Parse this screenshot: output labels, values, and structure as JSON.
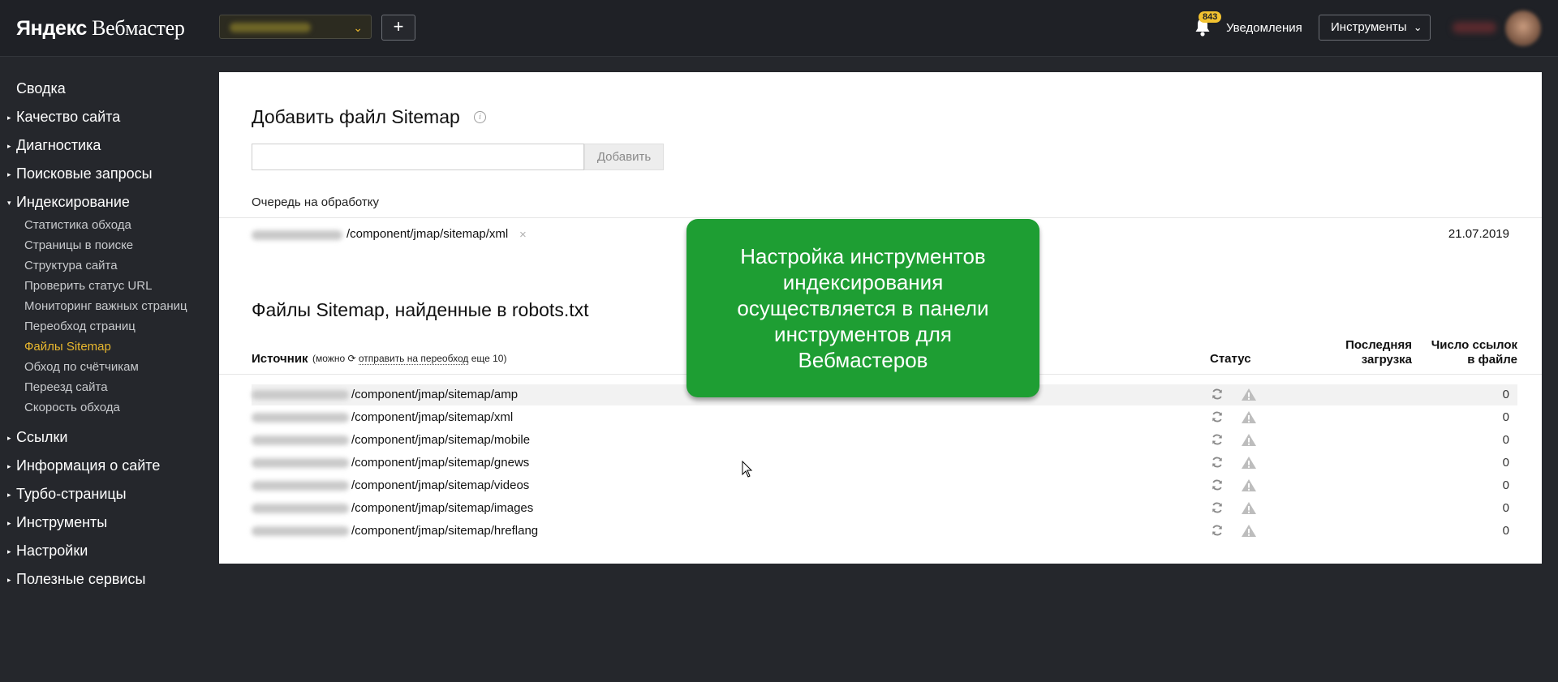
{
  "header": {
    "logo_brand": "Яндекс",
    "logo_product": "Вебмастер",
    "add_button": "+",
    "notifications_count": "843",
    "notifications_label": "Уведомления",
    "tools_label": "Инструменты",
    "tools_chevron": "⌄",
    "site_chevron": "⌄"
  },
  "sidebar": {
    "top_items": [
      {
        "label": "Сводка",
        "arrow": ""
      },
      {
        "label": "Качество сайта",
        "arrow": "▸"
      },
      {
        "label": "Диагностика",
        "arrow": "▸"
      },
      {
        "label": "Поисковые запросы",
        "arrow": "▸"
      },
      {
        "label": "Индексирование",
        "arrow": "▾"
      },
      {
        "label": "Ссылки",
        "arrow": "▸"
      },
      {
        "label": "Информация о сайте",
        "arrow": "▸"
      },
      {
        "label": "Турбо-страницы",
        "arrow": "▸"
      },
      {
        "label": "Инструменты",
        "arrow": "▸"
      },
      {
        "label": "Настройки",
        "arrow": "▸"
      },
      {
        "label": "Полезные сервисы",
        "arrow": "▸"
      }
    ],
    "indexing_items": [
      {
        "label": "Статистика обхода"
      },
      {
        "label": "Страницы в поиске"
      },
      {
        "label": "Структура сайта"
      },
      {
        "label": "Проверить статус URL"
      },
      {
        "label": "Мониторинг важных страниц"
      },
      {
        "label": "Переобход страниц"
      },
      {
        "label": "Файлы Sitemap"
      },
      {
        "label": "Обход по счётчикам"
      },
      {
        "label": "Переезд сайта"
      },
      {
        "label": "Скорость обхода"
      }
    ],
    "active_item": "Файлы Sitemap"
  },
  "add_sitemap": {
    "title": "Добавить файл Sitemap",
    "info_icon": "i",
    "input_value": "",
    "button_label": "Добавить"
  },
  "queue": {
    "title": "Очередь на обработку",
    "items": [
      {
        "url": "/component/jmap/sitemap/xml",
        "remove": "×",
        "date": "21.07.2019"
      }
    ]
  },
  "robots": {
    "title": "Файлы Sitemap, найденные в robots.txt",
    "col_source": "Источник",
    "note_prefix": "(можно ",
    "note_icon": "⟳",
    "note_link": "отправить на переобход",
    "note_suffix": " еще 10)",
    "col_status": "Статус",
    "col_last_line1": "Последняя",
    "col_last_line2": "загрузка",
    "col_count_line1": "Число ссылок",
    "col_count_line2": "в файле",
    "rows": [
      {
        "url": "/component/jmap/sitemap/amp",
        "count": "0"
      },
      {
        "url": "/component/jmap/sitemap/xml",
        "count": "0"
      },
      {
        "url": "/component/jmap/sitemap/mobile",
        "count": "0"
      },
      {
        "url": "/component/jmap/sitemap/gnews",
        "count": "0"
      },
      {
        "url": "/component/jmap/sitemap/videos",
        "count": "0"
      },
      {
        "url": "/component/jmap/sitemap/images",
        "count": "0"
      },
      {
        "url": "/component/jmap/sitemap/hreflang",
        "count": "0"
      }
    ]
  },
  "callout": {
    "text": "Настройка инструментов индексирования осуществляется в панели инструментов для Вебмастеров"
  },
  "colors": {
    "accent": "#e8b72e",
    "callout": "#1e9e33",
    "background": "#25272c"
  }
}
